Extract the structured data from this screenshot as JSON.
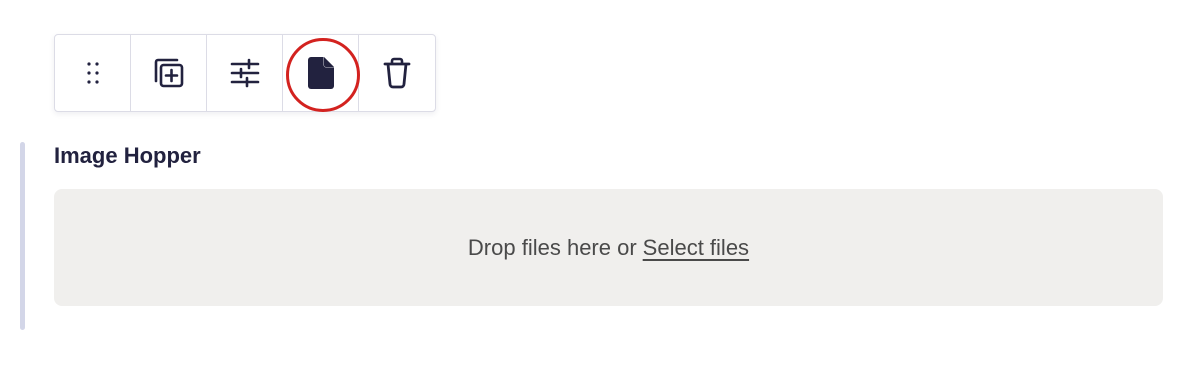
{
  "toolbar": {
    "buttons": [
      {
        "name": "drag-handle",
        "icon": "drag-dots-icon"
      },
      {
        "name": "duplicate",
        "icon": "duplicate-plus-icon"
      },
      {
        "name": "settings",
        "icon": "sliders-icon"
      },
      {
        "name": "document",
        "icon": "document-icon",
        "highlighted": true
      },
      {
        "name": "delete",
        "icon": "trash-icon"
      }
    ],
    "icon_color": "#22223f",
    "highlight_color": "#d3221f"
  },
  "block": {
    "title": "Image Hopper",
    "dropzone": {
      "text": "Drop files here or",
      "link_label": "Select files"
    }
  }
}
